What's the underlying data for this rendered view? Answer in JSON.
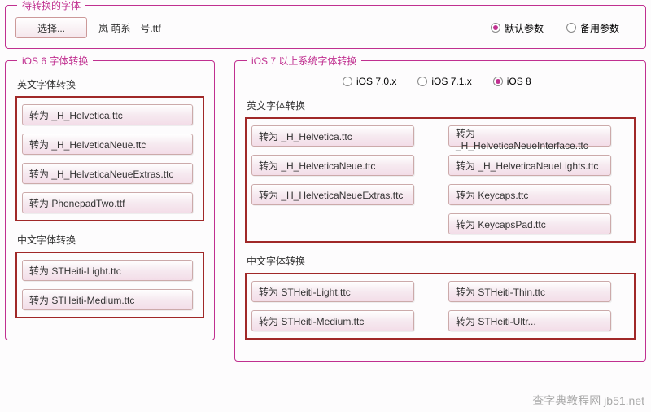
{
  "top": {
    "legend": "待转换的字体",
    "choose_label": "选择...",
    "filename": "岚 萌系一号.ttf",
    "radios": {
      "default": "默认参数",
      "backup": "备用参数",
      "selected": "default"
    }
  },
  "ios6": {
    "legend": "iOS 6 字体转换",
    "en_label": "英文字体转换",
    "en_items": [
      "转为 _H_Helvetica.ttc",
      "转为 _H_HelveticaNeue.ttc",
      "转为 _H_HelveticaNeueExtras.ttc",
      "转为 PhonepadTwo.ttf"
    ],
    "cn_label": "中文字体转换",
    "cn_items": [
      "转为 STHeiti-Light.ttc",
      "转为 STHeiti-Medium.ttc"
    ]
  },
  "ios7": {
    "legend": "iOS 7 以上系统字体转换",
    "versions": {
      "v70": "iOS 7.0.x",
      "v71": "iOS 7.1.x",
      "v8": "iOS 8",
      "selected": "v8"
    },
    "en_label": "英文字体转换",
    "en_items": [
      "转为 _H_Helvetica.ttc",
      "转为 _H_HelveticaNeueInterface.ttc",
      "转为 _H_HelveticaNeue.ttc",
      "转为 _H_HelveticaNeueLights.ttc",
      "转为 _H_HelveticaNeueExtras.ttc",
      "转为 Keycaps.ttc",
      "",
      "转为 KeycapsPad.ttc"
    ],
    "cn_label": "中文字体转换",
    "cn_items": [
      "转为 STHeiti-Light.ttc",
      "转为 STHeiti-Thin.ttc",
      "转为 STHeiti-Medium.ttc",
      "转为 STHeiti-Ultr..."
    ]
  },
  "watermark": "查字典教程网 jb51.net"
}
